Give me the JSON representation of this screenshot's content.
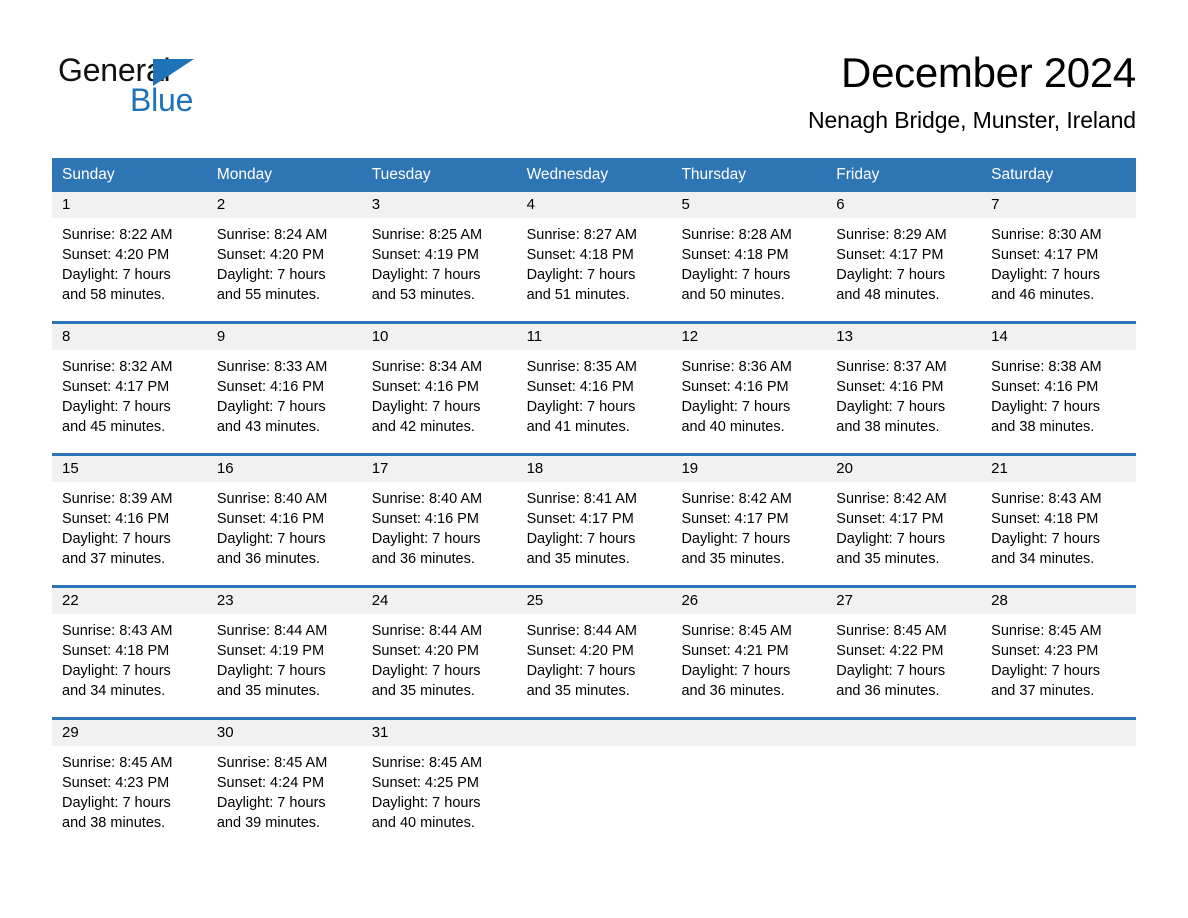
{
  "brand": {
    "name_part1": "General",
    "name_part2": "Blue",
    "accent_color": "#1e72b8"
  },
  "header": {
    "month_title": "December 2024",
    "location": "Nenagh Bridge, Munster, Ireland"
  },
  "calendar": {
    "header_color": "#2e75b6",
    "day_band_color": "#f1f1f1",
    "weekdays": [
      "Sunday",
      "Monday",
      "Tuesday",
      "Wednesday",
      "Thursday",
      "Friday",
      "Saturday"
    ],
    "weeks": [
      {
        "days": [
          {
            "number": "1",
            "sunrise": "Sunrise: 8:22 AM",
            "sunset": "Sunset: 4:20 PM",
            "daylight_line1": "Daylight: 7 hours",
            "daylight_line2": "and 58 minutes."
          },
          {
            "number": "2",
            "sunrise": "Sunrise: 8:24 AM",
            "sunset": "Sunset: 4:20 PM",
            "daylight_line1": "Daylight: 7 hours",
            "daylight_line2": "and 55 minutes."
          },
          {
            "number": "3",
            "sunrise": "Sunrise: 8:25 AM",
            "sunset": "Sunset: 4:19 PM",
            "daylight_line1": "Daylight: 7 hours",
            "daylight_line2": "and 53 minutes."
          },
          {
            "number": "4",
            "sunrise": "Sunrise: 8:27 AM",
            "sunset": "Sunset: 4:18 PM",
            "daylight_line1": "Daylight: 7 hours",
            "daylight_line2": "and 51 minutes."
          },
          {
            "number": "5",
            "sunrise": "Sunrise: 8:28 AM",
            "sunset": "Sunset: 4:18 PM",
            "daylight_line1": "Daylight: 7 hours",
            "daylight_line2": "and 50 minutes."
          },
          {
            "number": "6",
            "sunrise": "Sunrise: 8:29 AM",
            "sunset": "Sunset: 4:17 PM",
            "daylight_line1": "Daylight: 7 hours",
            "daylight_line2": "and 48 minutes."
          },
          {
            "number": "7",
            "sunrise": "Sunrise: 8:30 AM",
            "sunset": "Sunset: 4:17 PM",
            "daylight_line1": "Daylight: 7 hours",
            "daylight_line2": "and 46 minutes."
          }
        ]
      },
      {
        "days": [
          {
            "number": "8",
            "sunrise": "Sunrise: 8:32 AM",
            "sunset": "Sunset: 4:17 PM",
            "daylight_line1": "Daylight: 7 hours",
            "daylight_line2": "and 45 minutes."
          },
          {
            "number": "9",
            "sunrise": "Sunrise: 8:33 AM",
            "sunset": "Sunset: 4:16 PM",
            "daylight_line1": "Daylight: 7 hours",
            "daylight_line2": "and 43 minutes."
          },
          {
            "number": "10",
            "sunrise": "Sunrise: 8:34 AM",
            "sunset": "Sunset: 4:16 PM",
            "daylight_line1": "Daylight: 7 hours",
            "daylight_line2": "and 42 minutes."
          },
          {
            "number": "11",
            "sunrise": "Sunrise: 8:35 AM",
            "sunset": "Sunset: 4:16 PM",
            "daylight_line1": "Daylight: 7 hours",
            "daylight_line2": "and 41 minutes."
          },
          {
            "number": "12",
            "sunrise": "Sunrise: 8:36 AM",
            "sunset": "Sunset: 4:16 PM",
            "daylight_line1": "Daylight: 7 hours",
            "daylight_line2": "and 40 minutes."
          },
          {
            "number": "13",
            "sunrise": "Sunrise: 8:37 AM",
            "sunset": "Sunset: 4:16 PM",
            "daylight_line1": "Daylight: 7 hours",
            "daylight_line2": "and 38 minutes."
          },
          {
            "number": "14",
            "sunrise": "Sunrise: 8:38 AM",
            "sunset": "Sunset: 4:16 PM",
            "daylight_line1": "Daylight: 7 hours",
            "daylight_line2": "and 38 minutes."
          }
        ]
      },
      {
        "days": [
          {
            "number": "15",
            "sunrise": "Sunrise: 8:39 AM",
            "sunset": "Sunset: 4:16 PM",
            "daylight_line1": "Daylight: 7 hours",
            "daylight_line2": "and 37 minutes."
          },
          {
            "number": "16",
            "sunrise": "Sunrise: 8:40 AM",
            "sunset": "Sunset: 4:16 PM",
            "daylight_line1": "Daylight: 7 hours",
            "daylight_line2": "and 36 minutes."
          },
          {
            "number": "17",
            "sunrise": "Sunrise: 8:40 AM",
            "sunset": "Sunset: 4:16 PM",
            "daylight_line1": "Daylight: 7 hours",
            "daylight_line2": "and 36 minutes."
          },
          {
            "number": "18",
            "sunrise": "Sunrise: 8:41 AM",
            "sunset": "Sunset: 4:17 PM",
            "daylight_line1": "Daylight: 7 hours",
            "daylight_line2": "and 35 minutes."
          },
          {
            "number": "19",
            "sunrise": "Sunrise: 8:42 AM",
            "sunset": "Sunset: 4:17 PM",
            "daylight_line1": "Daylight: 7 hours",
            "daylight_line2": "and 35 minutes."
          },
          {
            "number": "20",
            "sunrise": "Sunrise: 8:42 AM",
            "sunset": "Sunset: 4:17 PM",
            "daylight_line1": "Daylight: 7 hours",
            "daylight_line2": "and 35 minutes."
          },
          {
            "number": "21",
            "sunrise": "Sunrise: 8:43 AM",
            "sunset": "Sunset: 4:18 PM",
            "daylight_line1": "Daylight: 7 hours",
            "daylight_line2": "and 34 minutes."
          }
        ]
      },
      {
        "days": [
          {
            "number": "22",
            "sunrise": "Sunrise: 8:43 AM",
            "sunset": "Sunset: 4:18 PM",
            "daylight_line1": "Daylight: 7 hours",
            "daylight_line2": "and 34 minutes."
          },
          {
            "number": "23",
            "sunrise": "Sunrise: 8:44 AM",
            "sunset": "Sunset: 4:19 PM",
            "daylight_line1": "Daylight: 7 hours",
            "daylight_line2": "and 35 minutes."
          },
          {
            "number": "24",
            "sunrise": "Sunrise: 8:44 AM",
            "sunset": "Sunset: 4:20 PM",
            "daylight_line1": "Daylight: 7 hours",
            "daylight_line2": "and 35 minutes."
          },
          {
            "number": "25",
            "sunrise": "Sunrise: 8:44 AM",
            "sunset": "Sunset: 4:20 PM",
            "daylight_line1": "Daylight: 7 hours",
            "daylight_line2": "and 35 minutes."
          },
          {
            "number": "26",
            "sunrise": "Sunrise: 8:45 AM",
            "sunset": "Sunset: 4:21 PM",
            "daylight_line1": "Daylight: 7 hours",
            "daylight_line2": "and 36 minutes."
          },
          {
            "number": "27",
            "sunrise": "Sunrise: 8:45 AM",
            "sunset": "Sunset: 4:22 PM",
            "daylight_line1": "Daylight: 7 hours",
            "daylight_line2": "and 36 minutes."
          },
          {
            "number": "28",
            "sunrise": "Sunrise: 8:45 AM",
            "sunset": "Sunset: 4:23 PM",
            "daylight_line1": "Daylight: 7 hours",
            "daylight_line2": "and 37 minutes."
          }
        ]
      },
      {
        "days": [
          {
            "number": "29",
            "sunrise": "Sunrise: 8:45 AM",
            "sunset": "Sunset: 4:23 PM",
            "daylight_line1": "Daylight: 7 hours",
            "daylight_line2": "and 38 minutes."
          },
          {
            "number": "30",
            "sunrise": "Sunrise: 8:45 AM",
            "sunset": "Sunset: 4:24 PM",
            "daylight_line1": "Daylight: 7 hours",
            "daylight_line2": "and 39 minutes."
          },
          {
            "number": "31",
            "sunrise": "Sunrise: 8:45 AM",
            "sunset": "Sunset: 4:25 PM",
            "daylight_line1": "Daylight: 7 hours",
            "daylight_line2": "and 40 minutes."
          },
          {
            "number": "",
            "sunrise": "",
            "sunset": "",
            "daylight_line1": "",
            "daylight_line2": ""
          },
          {
            "number": "",
            "sunrise": "",
            "sunset": "",
            "daylight_line1": "",
            "daylight_line2": ""
          },
          {
            "number": "",
            "sunrise": "",
            "sunset": "",
            "daylight_line1": "",
            "daylight_line2": ""
          },
          {
            "number": "",
            "sunrise": "",
            "sunset": "",
            "daylight_line1": "",
            "daylight_line2": ""
          }
        ]
      }
    ]
  }
}
